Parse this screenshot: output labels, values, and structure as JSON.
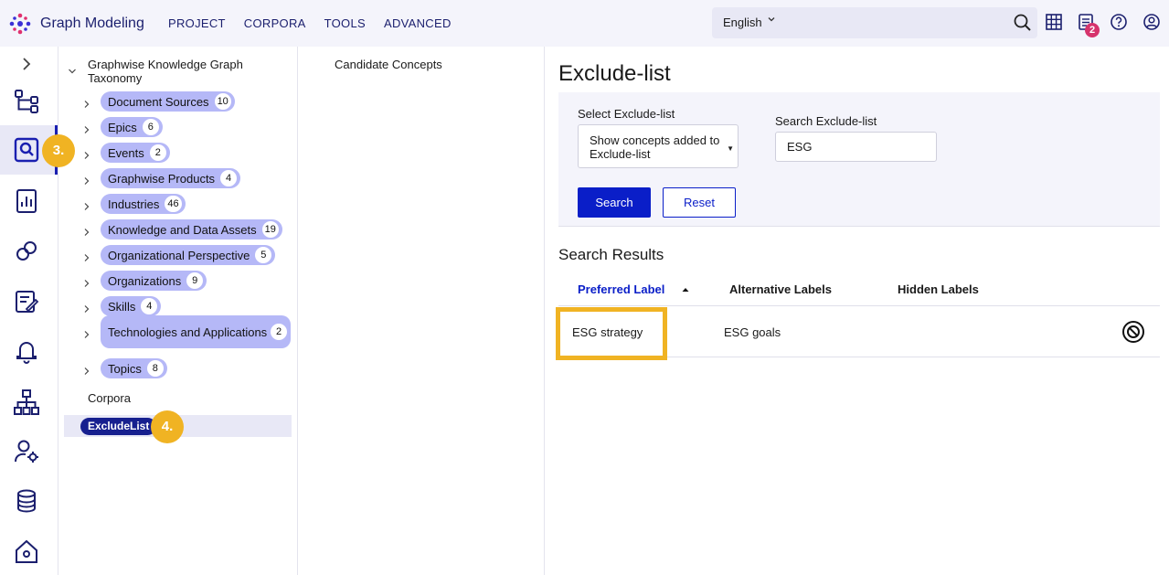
{
  "app": {
    "name": "Graph Modeling"
  },
  "nav": [
    "PROJECT",
    "CORPORA",
    "TOOLS",
    "ADVANCED"
  ],
  "language": "English",
  "notifications_count": "2",
  "steps": {
    "rail_step": "3.",
    "tree_step": "4."
  },
  "tree": {
    "root": "Graphwise Knowledge Graph Taxonomy",
    "items": [
      {
        "label": "Document Sources",
        "count": "10"
      },
      {
        "label": "Epics",
        "count": "6"
      },
      {
        "label": "Events",
        "count": "2"
      },
      {
        "label": "Graphwise Products",
        "count": "4"
      },
      {
        "label": "Industries",
        "count": "46"
      },
      {
        "label": "Knowledge and Data Assets",
        "count": "19"
      },
      {
        "label": "Organizational Perspective",
        "count": "5"
      },
      {
        "label": "Organizations",
        "count": "9"
      },
      {
        "label": "Skills",
        "count": "4"
      },
      {
        "label": "Technologies and Applications",
        "count": "2"
      },
      {
        "label": "Topics",
        "count": "8"
      }
    ],
    "corpora_label": "Corpora",
    "selected_corpus": "ExcludeList"
  },
  "candidate": {
    "title": "Candidate Concepts"
  },
  "main": {
    "title": "Exclude-list",
    "filter": {
      "select_label": "Select Exclude-list",
      "select_value": "Show concepts added to Exclude-list",
      "search_label": "Search Exclude-list",
      "search_value": "ESG",
      "search_button": "Search",
      "reset_button": "Reset"
    },
    "results_title": "Search Results",
    "columns": [
      "Preferred Label",
      "Alternative Labels",
      "Hidden Labels"
    ],
    "rows": [
      {
        "preferred": "ESG strategy",
        "alternative": "ESG goals",
        "hidden": ""
      }
    ]
  },
  "colors": {
    "accent": "#0a1ec8",
    "chip": "#b5b8f7",
    "highlight": "#f0b323",
    "badge": "#d6336c"
  }
}
